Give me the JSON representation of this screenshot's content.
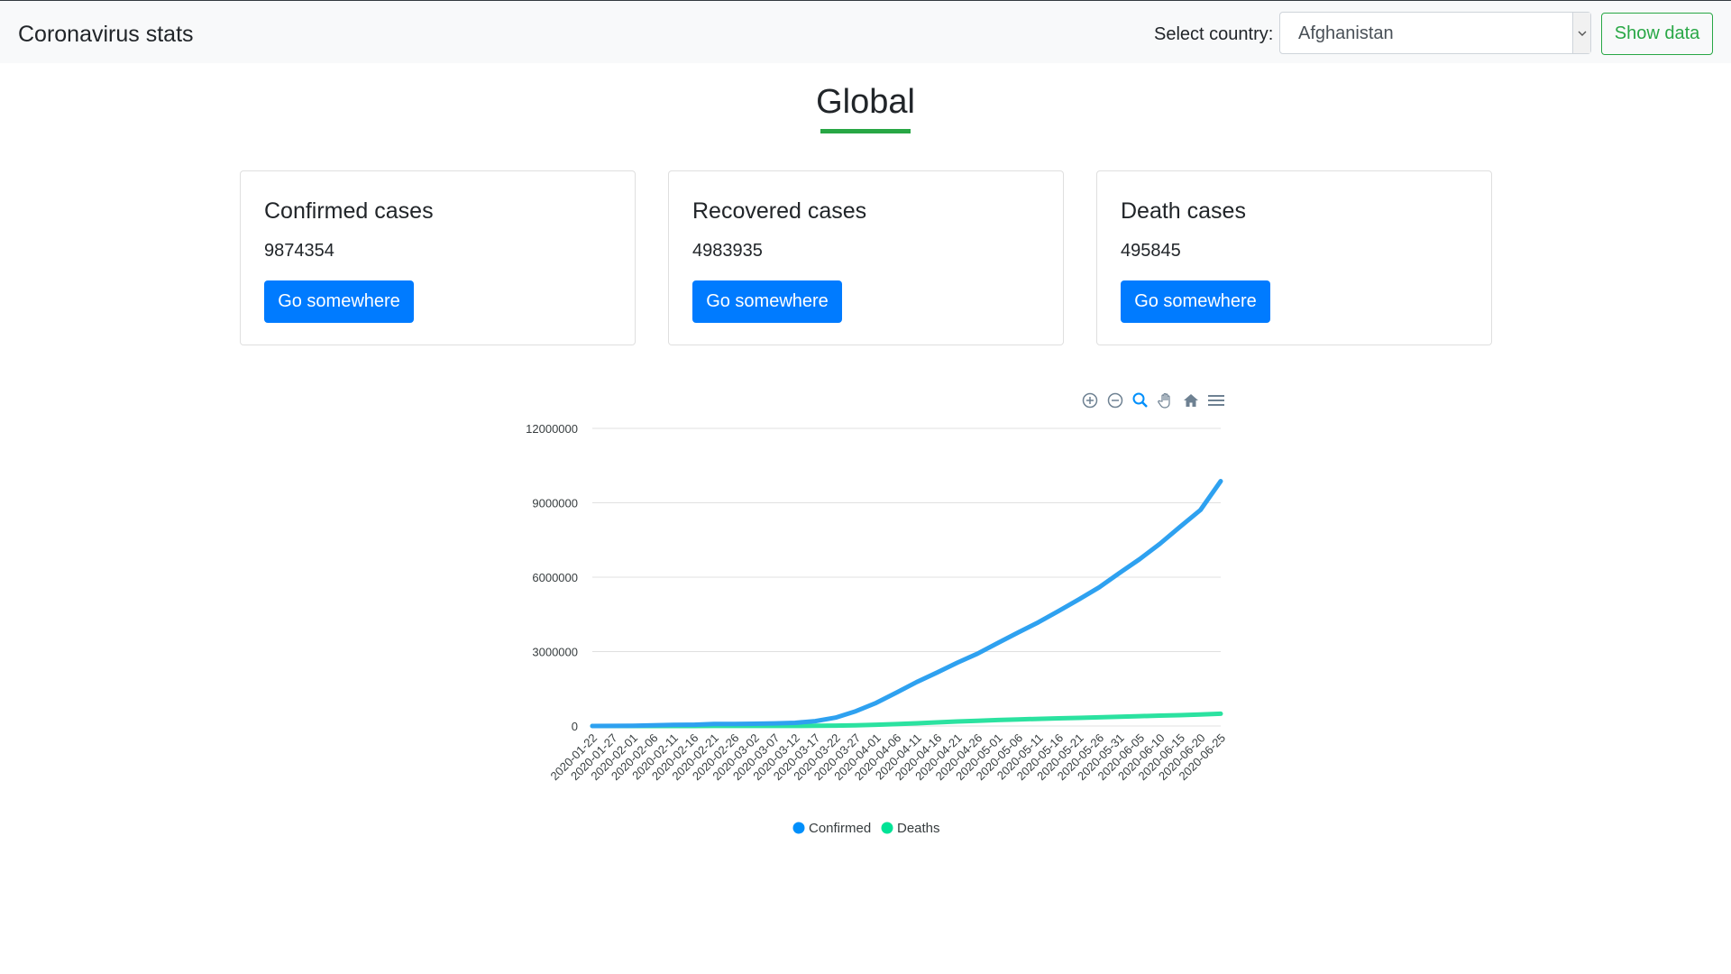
{
  "navbar": {
    "brand": "Coronavirus stats",
    "select_label": "Select country:",
    "selected_country": "Afghanistan",
    "show_button": "Show data"
  },
  "main": {
    "title": "Global",
    "cards": [
      {
        "title": "Confirmed cases",
        "value": "9874354",
        "button": "Go somewhere"
      },
      {
        "title": "Recovered cases",
        "value": "4983935",
        "button": "Go somewhere"
      },
      {
        "title": "Death cases",
        "value": "495845",
        "button": "Go somewhere"
      }
    ]
  },
  "toolbar": {
    "icons": [
      "zoom-in-icon",
      "zoom-out-icon",
      "selection-zoom-icon",
      "pan-icon",
      "home-reset-icon",
      "menu-icon"
    ]
  },
  "colors": {
    "confirmed": "#2ea1f0",
    "deaths": "#2be2a0",
    "accent_green": "#28a745",
    "primary_blue": "#007bff"
  },
  "chart_data": {
    "type": "line",
    "categories": [
      "2020-01-22",
      "2020-01-27",
      "2020-02-01",
      "2020-02-06",
      "2020-02-11",
      "2020-02-16",
      "2020-02-21",
      "2020-02-26",
      "2020-03-02",
      "2020-03-07",
      "2020-03-12",
      "2020-03-17",
      "2020-03-22",
      "2020-03-27",
      "2020-04-01",
      "2020-04-06",
      "2020-04-11",
      "2020-04-16",
      "2020-04-21",
      "2020-04-26",
      "2020-05-01",
      "2020-05-06",
      "2020-05-11",
      "2020-05-16",
      "2020-05-21",
      "2020-05-26",
      "2020-05-31",
      "2020-06-05",
      "2020-06-10",
      "2020-06-15",
      "2020-06-20",
      "2020-06-25"
    ],
    "series": [
      {
        "name": "Confirmed",
        "values": [
          555,
          2927,
          12038,
          30818,
          45221,
          51174,
          78572,
          81395,
          90306,
          105821,
          128343,
          197102,
          337553,
          595224,
          932605,
          1346004,
          1772323,
          2151199,
          2549046,
          2917575,
          3343777,
          3768689,
          4177504,
          4634068,
          5102424,
          5589626,
          6165944,
          6727361,
          7347025,
          8034461,
          8708008,
          9874354
        ]
      },
      {
        "name": "Deaths",
        "values": [
          17,
          82,
          259,
          565,
          1118,
          1666,
          2248,
          2770,
          3085,
          3557,
          4720,
          7905,
          14652,
          30384,
          50433,
          74565,
          108503,
          146088,
          180289,
          210260,
          239604,
          265862,
          286355,
          309303,
          328172,
          347704,
          370347,
          395000,
          417000,
          437000,
          461000,
          495845
        ]
      }
    ],
    "y_ticks": [
      "12000000",
      "9000000",
      "6000000",
      "3000000",
      "0"
    ],
    "ylim": [
      0,
      12000000
    ],
    "legend": [
      "Confirmed",
      "Deaths"
    ],
    "legend_position": "bottom",
    "grid": true
  }
}
